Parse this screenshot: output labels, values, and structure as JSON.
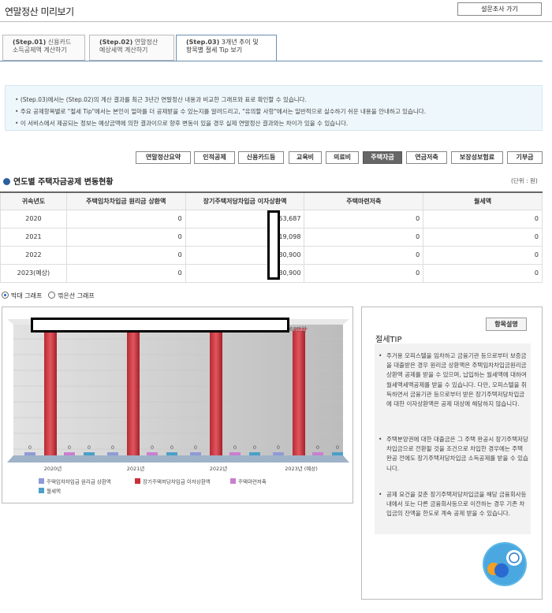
{
  "header": {
    "title": "연말정산 미리보기",
    "survey_button": "설문조사 가기"
  },
  "tabs": [
    {
      "step": "(Step.01)",
      "line1": "신용카드",
      "line2": "소득공제액 계산하기"
    },
    {
      "step": "(Step.02)",
      "line1": "연말정산",
      "line2": "예상세액 계산하기"
    },
    {
      "step": "(Step.03)",
      "line1": "3개년 추이 및",
      "line2": "항목별 절세 Tip 보기"
    }
  ],
  "info": [
    "(Step.03)에서는 (Step.02)의 계산 결과를 최근 3년간 연말정산 내용과 비교한 그래프와 표로 확인할 수 있습니다.",
    "주요 공제항목별로 \"절세 Tip\"에서는 본인이 얼마를 더 공제받을 수 있는지를 알려드리고, \"유의할 사항\"에서는 일반적으로 실수하기 쉬운 내용을 안내하고 있습니다.",
    "이 서비스에서 제공되는 정보는 예상금액에 의한 결과이므로 향후 변동이 있을 경우 실제 연말정산 결과와는 차이가 있을 수 있습니다."
  ],
  "categories": [
    "연말정산요약",
    "인적공제",
    "신용카드등",
    "교육비",
    "의료비",
    "주택자금",
    "연금저축",
    "보장성보험료",
    "기부금"
  ],
  "section": {
    "title": "연도별 주택자금공제 변동현황",
    "unit": "(단위 : 원)"
  },
  "table": {
    "headers": [
      "귀속년도",
      "주택임차차입금 원리금 상환액",
      "장기주택저당차입금 이자상환액",
      "주택마련저축",
      "월세액"
    ],
    "rows": [
      [
        "2020",
        "0",
        "53,687",
        "0",
        "0"
      ],
      [
        "2021",
        "0",
        "19,098",
        "0",
        "0"
      ],
      [
        "2022",
        "0",
        "30,900",
        "0",
        "0"
      ],
      [
        "2023(예상)",
        "0",
        "30,900",
        "0",
        "0"
      ]
    ]
  },
  "chart_options": {
    "bar": "막대 그래프",
    "line": "꺾은선 그래프"
  },
  "chart_data": {
    "type": "bar",
    "categories": [
      "2020년",
      "2021년",
      "2022년",
      "2023년 (예상)"
    ],
    "series": [
      {
        "name": "주택임차차입금 원리금 상환액",
        "values": [
          0,
          0,
          0,
          0
        ],
        "color": "#8f9bd6"
      },
      {
        "name": "장기주택저당차입금 이자상환액",
        "values": [
          null,
          null,
          null,
          null
        ],
        "color": "#c8303a"
      },
      {
        "name": "주택마련저축",
        "values": [
          0,
          0,
          0,
          0
        ],
        "color": "#c97fd0"
      },
      {
        "name": "월세액",
        "values": [
          0,
          0,
          0,
          0
        ],
        "color": "#4aa0c8"
      }
    ],
    "visible_label": "68만원",
    "legend_position": "bottom-left"
  },
  "tip": {
    "button": "항목설명",
    "title": "절세TIP",
    "items": [
      "주거용 오피스텔을 임차하고 금융기관 등으로부터 보증금을 대출받은 경우 원리금 상환액은 주택임차차입금원리금상환액 공제를 받을 수 있으며, 납입하는 월세액에 대하여 월세액세액공제를 받을 수 있습니다. 다만, 오피스텔을 취득하면서 금융기관 등으로부터 받은 장기주택저당차입금에 대한 이자상환액은 공제 대상에 해당하지 않습니다.",
      "주택분양권에 대한 대출금은 그 주택 완공시 장기주택저당차입금으로 전환될 것을 조건으로 차입한 경우에는 주택 완공 전에도 장기주택저당차입금 소득공제를 받을 수 있습니다.",
      "공제 요건을 갖춘 장기주택저당차입금을 해당 금융회사등 내에서 또는 다른 금융회사등으로 이전하는 경우 기존 차입금의 잔액을 한도로 계속 공제 받을 수 있습니다."
    ]
  },
  "colors": {
    "accent": "#2b5f9e",
    "info_bg": "#eef7fb",
    "active_category": "#666666"
  }
}
